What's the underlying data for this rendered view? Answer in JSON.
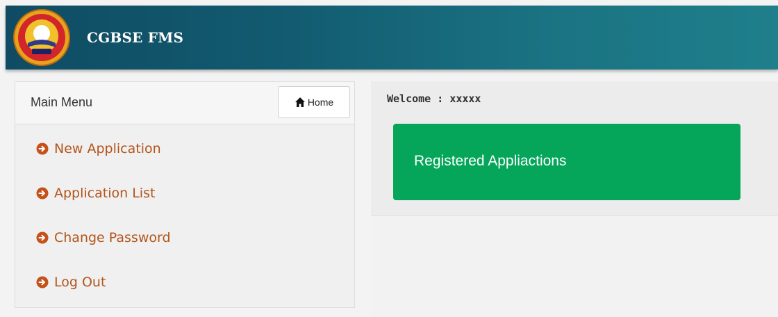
{
  "header": {
    "brand": "CGBSE FMS"
  },
  "sidebar": {
    "title": "Main Menu",
    "home_label": "Home",
    "items": [
      {
        "label": "New Application",
        "icon": "arrow-circle-right-icon"
      },
      {
        "label": "Application List",
        "icon": "arrow-circle-right-icon"
      },
      {
        "label": "Change Password",
        "icon": "arrow-circle-right-icon"
      },
      {
        "label": "Log Out",
        "icon": "arrow-circle-right-icon"
      }
    ]
  },
  "main": {
    "welcome_prefix": "Welcome : ",
    "username": "xxxxx",
    "card_label": "Registered Appliactions"
  },
  "colors": {
    "header_dark": "#0f4c63",
    "menu_link": "#b3541a",
    "card_green": "#05a65a"
  }
}
